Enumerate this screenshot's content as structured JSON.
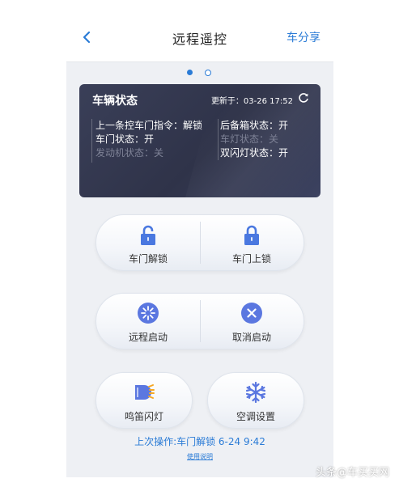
{
  "nav": {
    "title": "远程遥控",
    "share_label": "车分享"
  },
  "status": {
    "title": "车辆状态",
    "updated": "更新于：03-26 17:52",
    "left": [
      {
        "text": "上一条控车门指令：解锁",
        "dim": false
      },
      {
        "text": "车门状态：开",
        "dim": false
      },
      {
        "text": "发动机状态：关",
        "dim": true
      }
    ],
    "right": [
      {
        "text": "后备箱状态：开",
        "dim": false
      },
      {
        "text": "车灯状态：关",
        "dim": true
      },
      {
        "text": "双闪灯状态：开",
        "dim": false
      }
    ]
  },
  "buttons": {
    "unlock": "车门解锁",
    "lock": "车门上锁",
    "remote_start": "远程启动",
    "cancel_start": "取消启动",
    "horn_flash": "鸣笛闪灯",
    "ac": "空调设置"
  },
  "last_op": "上次操作:车门解锁 6-24 9:42",
  "help": "使用说明",
  "watermark": "头条@车买买网",
  "colors": {
    "accent": "#2a7bd6",
    "card": "#33374e",
    "icon_bg": "#4a78e0"
  },
  "icons": [
    "chevron-left-icon",
    "refresh-icon",
    "unlock-icon",
    "lock-icon",
    "spinner-icon",
    "cancel-x-icon",
    "headlight-icon",
    "snowflake-icon"
  ]
}
